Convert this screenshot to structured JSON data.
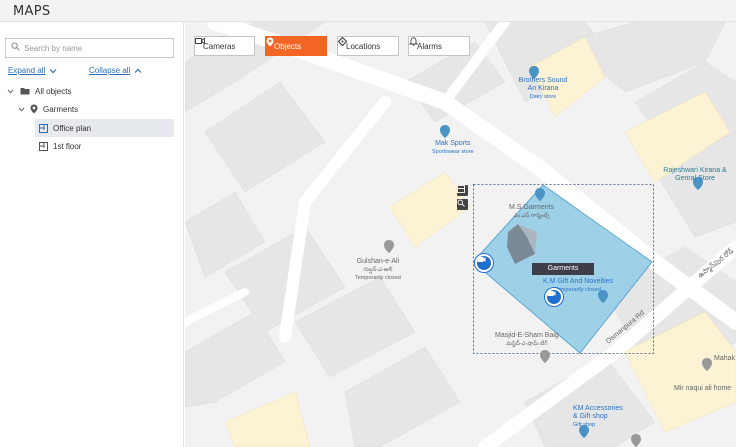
{
  "app": {
    "title": "MAPS"
  },
  "sidebar": {
    "search_placeholder": "Search by name",
    "expand_all": "Expand all",
    "collapse_all": "Collapse all",
    "tree": {
      "root": "All objects",
      "group": "Garments",
      "items": [
        "Office plan",
        "1st floor"
      ]
    }
  },
  "tabs": [
    {
      "label": "Cameras",
      "icon": "camera-icon",
      "active": false
    },
    {
      "label": "Objects",
      "icon": "map-pin-icon",
      "active": true
    },
    {
      "label": "Locations",
      "icon": "location-diamond-icon",
      "active": false
    },
    {
      "label": "Alarms",
      "icon": "bell-icon",
      "active": false
    }
  ],
  "map": {
    "object_label": "Garments",
    "places": [
      {
        "name": "Brothers Sound An Kirana",
        "sub": "Dairy store"
      },
      {
        "name": "Mak Sports",
        "sub": "Sportswear store"
      },
      {
        "name": "Rajeshwari Kirana & Genral Store",
        "sub": ""
      },
      {
        "name": "M.S.Garments",
        "sub": "ఎం.ఎస్ గార్మెంట్స్"
      },
      {
        "name": "Gulshan-e-Ali",
        "sub": "గుల్షన్-ఎ-అలీ",
        "status": "Temporarily closed"
      },
      {
        "name": "K.M Gift And Novelties",
        "sub": "Temporarily closed"
      },
      {
        "name": "Masjid-E-Sham Baig",
        "sub": "మస్జిద్-ఎ-షామ్ బేగ్"
      },
      {
        "name": "Osmanpura Rd",
        "sub": ""
      },
      {
        "name": "KM Accessories & Gift shop",
        "sub": "Gift shop"
      },
      {
        "name": "Mahak",
        "sub": ""
      },
      {
        "name": "Mir naqui ali home",
        "sub": ""
      },
      {
        "name": "ఉస్మాన్‌పుర రోడ్",
        "sub": ""
      }
    ]
  },
  "colors": {
    "accent": "#f26522",
    "link": "#2d6fb7",
    "zone": "#8fcbe6",
    "camera": "#1f6fd0"
  }
}
